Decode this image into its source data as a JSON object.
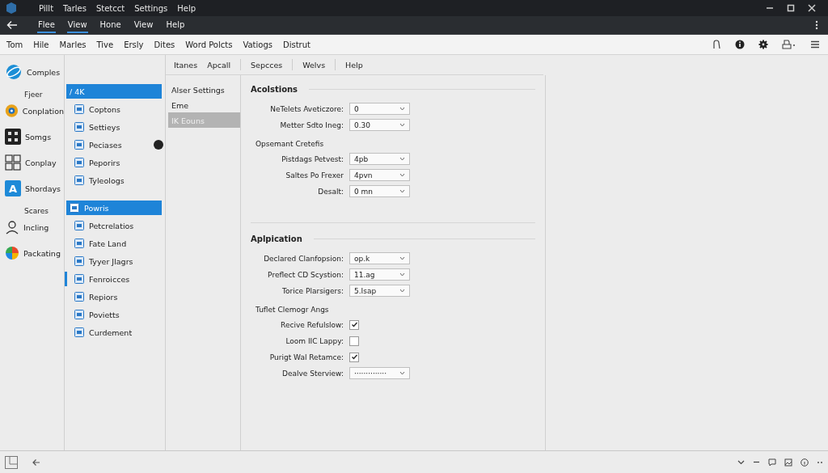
{
  "title_menu": [
    "Pillt",
    "Tarles",
    "Stetcct",
    "Settings",
    "Help"
  ],
  "nav_menu": [
    {
      "label": "Flee",
      "selected": true
    },
    {
      "label": "View",
      "selected": true
    },
    {
      "label": "Hone",
      "selected": false
    },
    {
      "label": "View",
      "selected": false
    },
    {
      "label": "Help",
      "selected": false
    }
  ],
  "toolbar": [
    "Tom",
    "Hile",
    "Marles",
    "Tive",
    "Ersly",
    "Dites",
    "Word Polcts",
    "Vatiogs",
    "Distrut"
  ],
  "apps": [
    {
      "kind": "item",
      "label": "Comples"
    },
    {
      "kind": "heading",
      "label": "Fjeer"
    },
    {
      "kind": "item",
      "label": "Conplation"
    },
    {
      "kind": "item",
      "label": "Somgs"
    },
    {
      "kind": "item",
      "label": "Conplay"
    },
    {
      "kind": "item",
      "label": "Shordays",
      "glyph": "A"
    },
    {
      "kind": "heading",
      "label": "Scares"
    },
    {
      "kind": "item",
      "label": "Incling"
    },
    {
      "kind": "item",
      "label": "Packating"
    }
  ],
  "nav": [
    {
      "label": "/ 4K",
      "selected": true,
      "marker": false
    },
    {
      "label": "Coptons",
      "selected": false,
      "marker": false
    },
    {
      "label": "Settieys",
      "selected": false,
      "marker": false
    },
    {
      "label": "Peciases",
      "selected": false,
      "marker": false,
      "badge": true
    },
    {
      "label": "Peporirs",
      "selected": false,
      "marker": false
    },
    {
      "label": "Tyleologs",
      "selected": false,
      "marker": false
    },
    {
      "label": "Powris",
      "selected": true,
      "marker": false
    },
    {
      "label": "Petcrelatios",
      "selected": false,
      "marker": false
    },
    {
      "label": "Fate Land",
      "selected": false,
      "marker": false
    },
    {
      "label": "Tyyer Jlagrs",
      "selected": false,
      "marker": false
    },
    {
      "label": "Fenroicces",
      "selected": false,
      "marker": true
    },
    {
      "label": "Repiors",
      "selected": false,
      "marker": false
    },
    {
      "label": "Povietts",
      "selected": false,
      "marker": false
    },
    {
      "label": "Curdement",
      "selected": false,
      "marker": false
    }
  ],
  "tabs": [
    "Itanes",
    "Apcall",
    "Sepcces",
    "Welvs",
    "Help"
  ],
  "subnav": [
    {
      "label": "Alser Settings",
      "selected": false
    },
    {
      "label": "Eme",
      "selected": false
    },
    {
      "label": "IK Eouns",
      "selected": true
    }
  ],
  "sections": [
    {
      "title": "Acolstions",
      "rows": [
        {
          "kind": "select",
          "label": "NeTelets Aveticzore:",
          "value": "0"
        },
        {
          "kind": "select",
          "label": "Metter Sdto Ineg:",
          "value": "0.30"
        },
        {
          "kind": "heading",
          "label": "Opsemant Cretefis"
        },
        {
          "kind": "select",
          "label": "Pistdags Petvest:",
          "value": "4pb"
        },
        {
          "kind": "select",
          "label": "Saltes Po Frexer",
          "value": "4pvn"
        },
        {
          "kind": "select",
          "label": "Desalt:",
          "value": "0 mn"
        }
      ]
    },
    {
      "title": "Aplpication",
      "rows": [
        {
          "kind": "select",
          "label": "Declared Clanfopsion:",
          "value": "op.k"
        },
        {
          "kind": "select",
          "label": "Preflect CD Scystion:",
          "value": "11.ag"
        },
        {
          "kind": "select",
          "label": "Torice Plarsigers:",
          "value": "5.Isap"
        },
        {
          "kind": "heading",
          "label": "Tuflet Clemogr Angs"
        },
        {
          "kind": "check",
          "label": "Recive Refulslow:",
          "checked": true
        },
        {
          "kind": "check",
          "label": "Loom IIC Lappy:",
          "checked": false
        },
        {
          "kind": "check",
          "label": "Purigt Wal Retamce:",
          "checked": true
        },
        {
          "kind": "select",
          "label": "Dealve Sterview:",
          "value": "··············"
        }
      ]
    }
  ]
}
